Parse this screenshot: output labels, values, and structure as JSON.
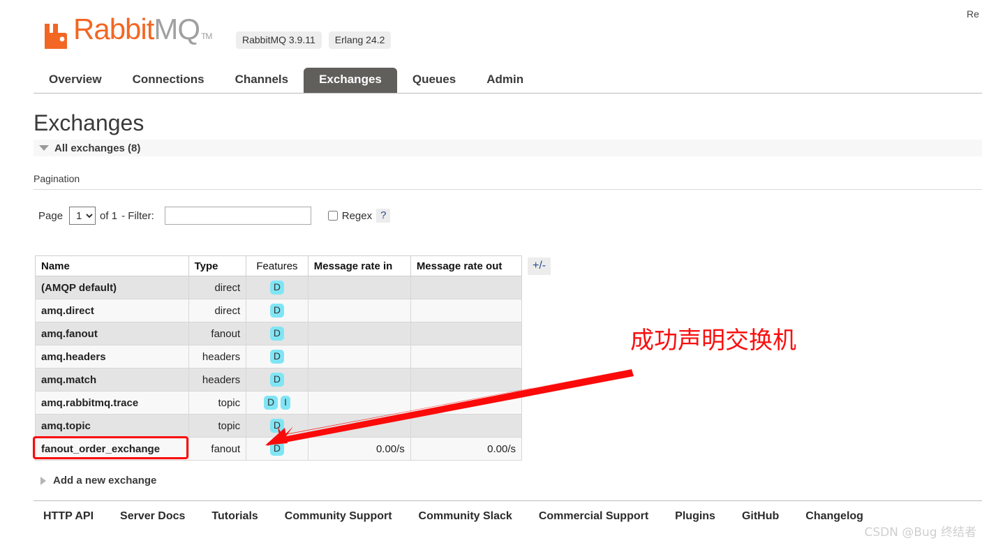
{
  "header": {
    "logo_rabbit": "Rabbit",
    "logo_mq": "MQ",
    "logo_tm": "TM",
    "logo_icon": "rabbit-head-icon",
    "brand_color": "#f26724",
    "version_badges": [
      "RabbitMQ 3.9.11",
      "Erlang 24.2"
    ],
    "refresh_note": "Re"
  },
  "tabs": [
    {
      "label": "Overview",
      "active": false
    },
    {
      "label": "Connections",
      "active": false
    },
    {
      "label": "Channels",
      "active": false
    },
    {
      "label": "Exchanges",
      "active": true
    },
    {
      "label": "Queues",
      "active": false
    },
    {
      "label": "Admin",
      "active": false
    }
  ],
  "page": {
    "title": "Exchanges",
    "section_label": "All exchanges (8)",
    "section_count": 8
  },
  "pagination": {
    "heading": "Pagination",
    "page_word": "Page",
    "page_value": "1",
    "page_options": [
      "1"
    ],
    "of_text": "of 1",
    "filter_label": "- Filter:",
    "filter_value": "",
    "filter_placeholder": "",
    "regex_label": "Regex",
    "regex_checked": false,
    "help_label": "?"
  },
  "table": {
    "columns": [
      "Name",
      "Type",
      "Features",
      "Message rate in",
      "Message rate out"
    ],
    "toggle_columns_label": "+/-",
    "rows": [
      {
        "name": "(AMQP default)",
        "type": "direct",
        "features": [
          "D"
        ],
        "rate_in": "",
        "rate_out": "",
        "highlighted": false
      },
      {
        "name": "amq.direct",
        "type": "direct",
        "features": [
          "D"
        ],
        "rate_in": "",
        "rate_out": "",
        "highlighted": false
      },
      {
        "name": "amq.fanout",
        "type": "fanout",
        "features": [
          "D"
        ],
        "rate_in": "",
        "rate_out": "",
        "highlighted": false
      },
      {
        "name": "amq.headers",
        "type": "headers",
        "features": [
          "D"
        ],
        "rate_in": "",
        "rate_out": "",
        "highlighted": false
      },
      {
        "name": "amq.match",
        "type": "headers",
        "features": [
          "D"
        ],
        "rate_in": "",
        "rate_out": "",
        "highlighted": false
      },
      {
        "name": "amq.rabbitmq.trace",
        "type": "topic",
        "features": [
          "D",
          "I"
        ],
        "rate_in": "",
        "rate_out": "",
        "highlighted": false
      },
      {
        "name": "amq.topic",
        "type": "topic",
        "features": [
          "D"
        ],
        "rate_in": "",
        "rate_out": "",
        "highlighted": false
      },
      {
        "name": "fanout_order_exchange",
        "type": "fanout",
        "features": [
          "D"
        ],
        "rate_in": "0.00/s",
        "rate_out": "0.00/s",
        "highlighted": true
      }
    ]
  },
  "annotation": {
    "text": "成功声明交换机",
    "color": "#fa0f0f",
    "arrow_name": "red-arrow-annotation",
    "highlight_target": "fanout_order_exchange"
  },
  "add_exchange": {
    "label": "Add a new exchange"
  },
  "footer": {
    "links": [
      "HTTP API",
      "Server Docs",
      "Tutorials",
      "Community Support",
      "Community Slack",
      "Commercial Support",
      "Plugins",
      "GitHub",
      "Changelog"
    ],
    "watermark": "CSDN @Bug 终结者"
  }
}
